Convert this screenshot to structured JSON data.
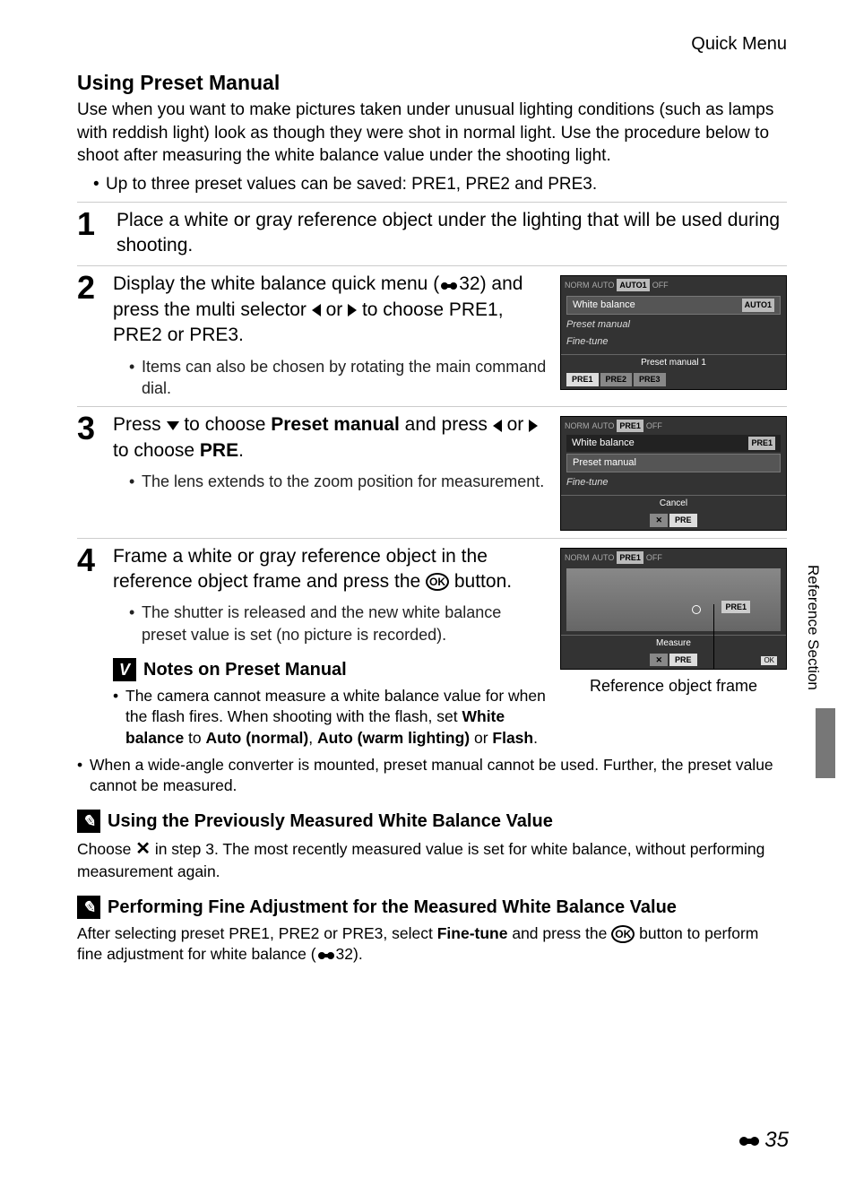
{
  "header": {
    "section": "Quick Menu"
  },
  "title": "Using Preset Manual",
  "intro": "Use when you want to make pictures taken under unusual lighting conditions (such as lamps with reddish light) look as though they were shot in normal light. Use the procedure below to shoot after measuring the white balance value under the shooting light.",
  "intro_bullet": "Up to three preset values can be saved: PRE1, PRE2 and PRE3.",
  "steps": {
    "s1": {
      "num": "1",
      "text": "Place a white or gray reference object under the lighting that will be used during shooting."
    },
    "s2": {
      "num": "2",
      "text_a": "Display the white balance quick menu (",
      "ref": "32",
      "text_b": ") and press the multi selector ",
      "text_c": " or ",
      "text_d": " to choose PRE1, PRE2 or PRE3.",
      "sub": "Items can also be chosen by rotating the main command dial."
    },
    "s3": {
      "num": "3",
      "text_a": "Press ",
      "text_b": " to choose ",
      "bold1": "Preset manual",
      "text_c": " and press ",
      "text_d": " or ",
      "text_e": " to choose ",
      "bold2": "PRE",
      "text_f": ".",
      "sub": "The lens extends to the zoom position for measurement."
    },
    "s4": {
      "num": "4",
      "text_a": "Frame a white or gray reference object in the reference object frame and press the ",
      "text_b": " button.",
      "sub": "The shutter is released and the new white balance preset value is set (no picture is recorded)."
    }
  },
  "screens": {
    "a": {
      "strip": [
        "NORM",
        "",
        "AUTO",
        "AUTO1",
        "OFF",
        "",
        ""
      ],
      "row_l": "White balance",
      "row_r": "AUTO1",
      "line1": "Preset manual",
      "line2": "Fine-tune",
      "foot": "Preset manual 1",
      "chips": [
        "PRE1",
        "PRE2",
        "PRE3"
      ]
    },
    "b": {
      "strip": [
        "NORM",
        "",
        "AUTO",
        "PRE1",
        "OFF",
        "",
        ""
      ],
      "line0": "White balance",
      "row_r": "PRE1",
      "row_l": "Preset manual",
      "line2": "Fine-tune",
      "foot": "Cancel",
      "chips": [
        "✕",
        "PRE"
      ]
    },
    "c": {
      "strip": [
        "NORM",
        "",
        "AUTO",
        "PRE1",
        "OFF",
        "",
        ""
      ],
      "row_r": "PRE1",
      "foot": "Measure",
      "chips": [
        "✕",
        "PRE"
      ],
      "ok": "OK",
      "caption": "Reference object frame"
    }
  },
  "notes": {
    "n1": {
      "title": "Notes on Preset Manual",
      "b1_a": "The camera cannot measure a white balance value for when the flash fires. When shooting with the flash, set ",
      "bold1": "White balance",
      "b1_b": " to ",
      "bold2": "Auto (normal)",
      "b1_c": ", ",
      "bold3": "Auto (warm lighting)",
      "b1_d": " or ",
      "bold4": "Flash",
      "b1_e": ".",
      "b2": "When a wide-angle converter is mounted, preset manual cannot be used. Further, the preset value cannot be measured."
    },
    "n2": {
      "title": "Using the Previously Measured White Balance Value",
      "a": "Choose ",
      "b": " in step 3. The most recently measured value is set for white balance, without performing measurement again."
    },
    "n3": {
      "title": "Performing Fine Adjustment for the Measured White Balance Value",
      "a": "After selecting preset PRE1, PRE2 or PRE3, select ",
      "bold1": "Fine-tune",
      "b": " and press the ",
      "c": " button to perform fine adjustment for white balance (",
      "ref": "32",
      "d": ")."
    }
  },
  "side_label": "Reference Section",
  "page": "35"
}
